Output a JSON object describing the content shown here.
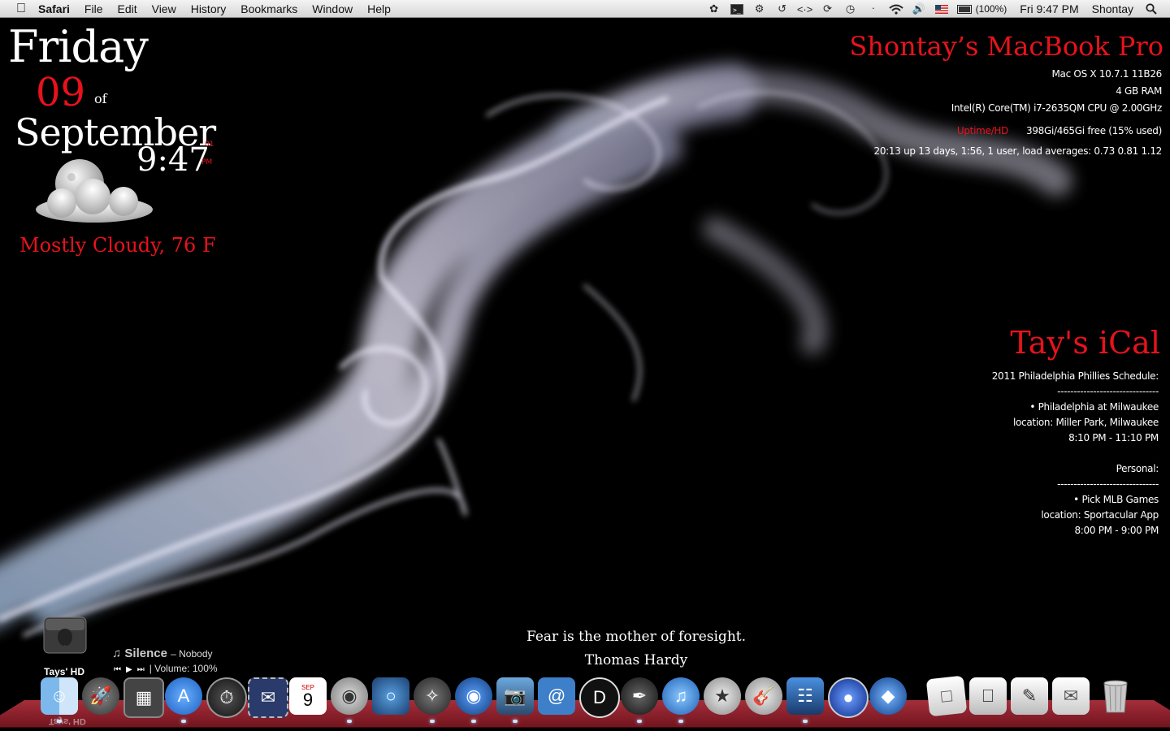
{
  "menubar": {
    "app_name": "Safari",
    "menus": [
      "File",
      "Edit",
      "View",
      "History",
      "Bookmarks",
      "Window",
      "Help"
    ],
    "status_icons": [
      "butterfly-icon",
      "terminal-icon",
      "gears-icon",
      "sync-icon",
      "code-icon",
      "refresh-icon",
      "time-machine-icon",
      "bluetooth-icon",
      "wifi-icon",
      "volume-icon",
      "us-flag-icon"
    ],
    "battery": "(100%)",
    "clock": "Fri 9:47 PM",
    "user": "Shontay"
  },
  "clock_widget": {
    "day": "Friday",
    "date_num": "09",
    "of": "of",
    "month": "September",
    "time": "9:47",
    "seconds": "01",
    "ampm": "PM"
  },
  "weather": {
    "text": "Mostly Cloudy, 76 F",
    "icon": "cloudy-moon-icon"
  },
  "system": {
    "name": "Shontay’s MacBook Pro",
    "os": "Mac OS X 10.7.1 11B26",
    "ram": "4 GB RAM",
    "cpu": "Intel(R) Core(TM) i7-2635QM CPU @ 2.00GHz",
    "uptime_label": "Uptime/HD",
    "disk": "398Gi/465Gi free (15% used)",
    "uptime": "20:13  up 13 days,  1:56, 1 user, load averages: 0.73 0.81 1.12"
  },
  "ical": {
    "title": "Tay's iCal",
    "lines": [
      "2011 Philadelphia Phillies Schedule:",
      "-------------------------------",
      "• Philadelphia at Milwaukee",
      "location: Miller Park, Milwaukee",
      "8:10 PM - 11:10 PM",
      "",
      "Personal:",
      "-------------------------------",
      "• Pick MLB Games",
      "location: Sportacular App",
      "8:00 PM - 9:00 PM"
    ]
  },
  "quote": {
    "text": "Fear is the mother of foresight.",
    "author": "Thomas Hardy"
  },
  "hd": {
    "label": "Tays' HD"
  },
  "music": {
    "title": "Silence",
    "artist": "Nobody",
    "volume": "| Volume: 100%"
  },
  "dock": {
    "icons": [
      "finder-icon",
      "launchpad-icon",
      "mission-control-icon",
      "app-store-icon",
      "dashboard-icon",
      "mail-stamp-icon",
      "ical-icon",
      "facetime-icon",
      "camera-icon",
      "safari-icon",
      "firefox-icon",
      "iphoto-icon",
      "address-book-icon",
      "dictionary-icon",
      "pen-tablet-icon",
      "itunes-icon",
      "imovie-icon",
      "garageband-icon",
      "system-monitor-icon",
      "blue-orb-icon",
      "network-globe-icon",
      "documents-stack-icon",
      "applications-stack-icon",
      "utilities-stack-icon",
      "mail-stack-icon",
      "trash-icon"
    ],
    "ical_date": "9",
    "ical_month": "SEP",
    "reflection": "Tays' HD"
  }
}
